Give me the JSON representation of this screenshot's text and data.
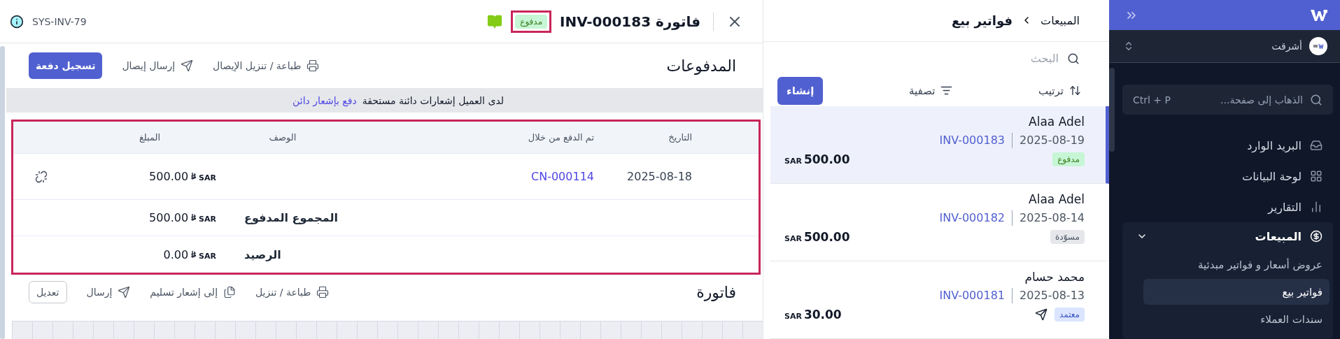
{
  "sidebar": {
    "org": {
      "name": "أشرقت"
    },
    "search": {
      "placeholder": "الذهاب إلى صفحة...",
      "shortcut": "Ctrl + P"
    },
    "items": [
      {
        "kind": "inbox",
        "label": "البريد الوارد",
        "selected": false
      },
      {
        "kind": "dashboard",
        "label": "لوحة البيانات",
        "selected": false
      },
      {
        "kind": "reports",
        "label": "التقارير",
        "selected": false
      },
      {
        "kind": "sales",
        "label": "المبيعات",
        "selected": false,
        "expanded": true,
        "children": [
          {
            "label": "عروض أسعار و فواتير مبدئية",
            "selected": false
          },
          {
            "label": "فواتير بيع",
            "selected": true
          },
          {
            "label": "سندات العملاء",
            "selected": false
          }
        ]
      }
    ]
  },
  "breadcrumb": [
    "المبيعات",
    "فواتير بيع"
  ],
  "list": {
    "search": {
      "placeholder": "البحث"
    },
    "sort_label": "ترتيب",
    "filter_label": "تصفية",
    "create_label": "إنشاء",
    "items": [
      {
        "customer": "Alaa Adel",
        "date": "2025-08-19",
        "number": "INV-000183",
        "status": {
          "kind": "paid",
          "label": "مدفوع"
        },
        "sent": false,
        "currency": "SAR",
        "amount": "500.00",
        "selected": true
      },
      {
        "customer": "Alaa Adel",
        "date": "2025-08-14",
        "number": "INV-000182",
        "status": {
          "kind": "draft",
          "label": "مسوّدة"
        },
        "sent": false,
        "currency": "SAR",
        "amount": "500.00",
        "selected": false
      },
      {
        "customer": "محمد حسام",
        "date": "2025-08-13",
        "number": "INV-000181",
        "status": {
          "kind": "approved",
          "label": "معتمد"
        },
        "sent": true,
        "currency": "SAR",
        "amount": "30.00",
        "selected": false
      }
    ]
  },
  "detail": {
    "title": "فاتورة INV-000183",
    "status": {
      "kind": "paid",
      "label": "مدفوع",
      "highlighted": true
    },
    "reference": "SYS-INV-79",
    "payments": {
      "title": "المدفوعات",
      "actions": [
        {
          "kind": "print",
          "label": "طباعة / تنزيل الإيصال"
        },
        {
          "kind": "send",
          "label": "إرسال إيصال"
        },
        {
          "kind": "primary",
          "label": "تسجيل دفعة"
        }
      ],
      "notice": {
        "text": "لدى العميل إشعارات دائنة مستحقة",
        "link": "دفع بإشعار دائن"
      },
      "table": {
        "highlighted": true,
        "columns": [
          "التاريخ",
          "تم الدفع من خلال",
          "الوصف",
          "المبلغ"
        ],
        "rows": [
          {
            "date": "2025-08-18",
            "paid_via": "CN-000114",
            "currency": "SAR",
            "amount": "500.00"
          }
        ],
        "totals": [
          {
            "label": "المجموع المدفوع",
            "currency": "SAR",
            "amount": "500.00"
          },
          {
            "label": "الرصيد",
            "currency": "SAR",
            "amount": "0.00"
          }
        ]
      }
    },
    "invoice": {
      "title": "فاتورة",
      "actions": [
        {
          "kind": "print",
          "label": "طباعة / تنزيل"
        },
        {
          "kind": "convert",
          "label": "إلى إشعار تسليم"
        },
        {
          "kind": "send",
          "label": "إرسال"
        },
        {
          "kind": "outline",
          "label": "تعديل"
        }
      ]
    }
  }
}
